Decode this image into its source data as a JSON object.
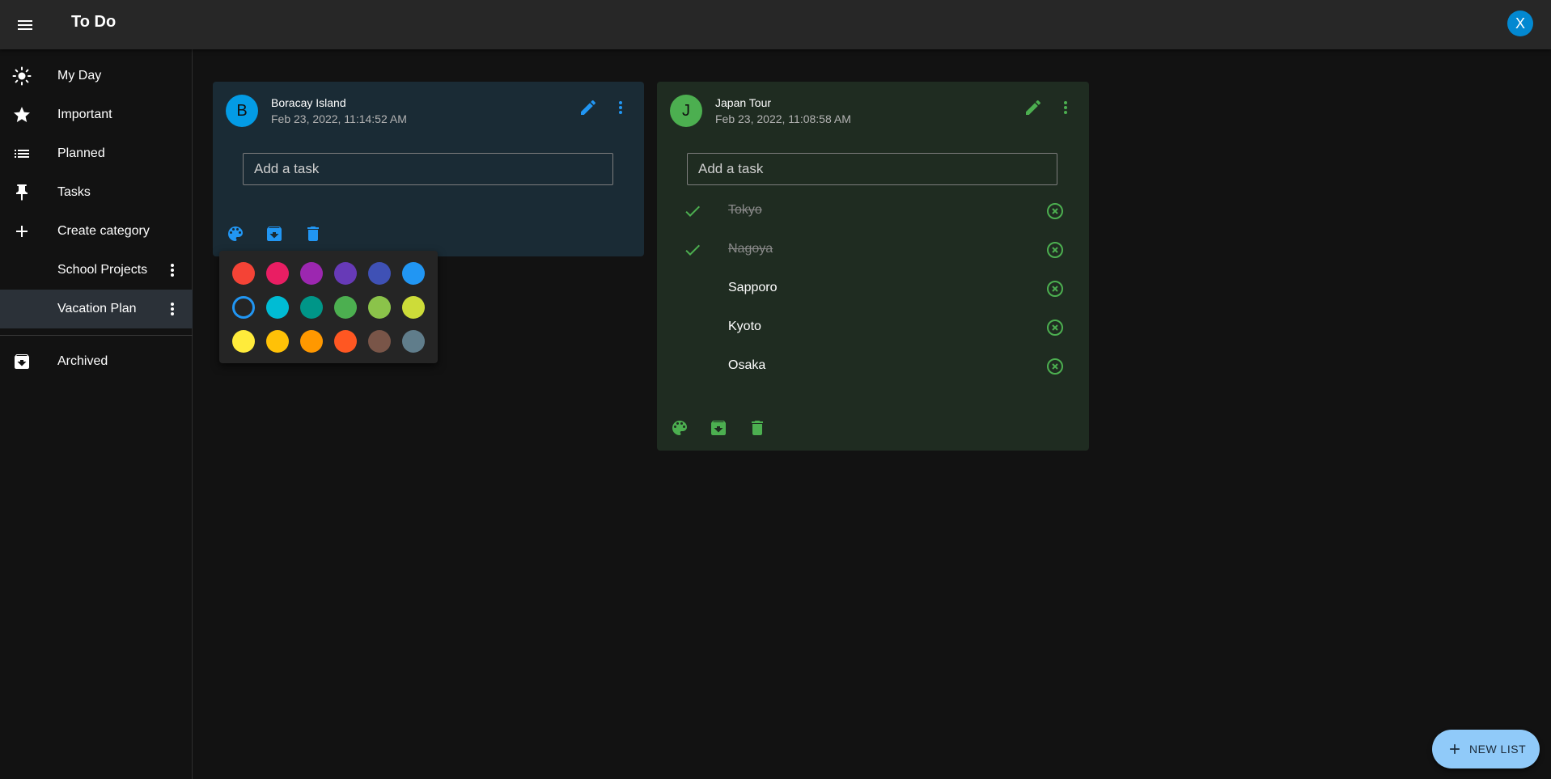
{
  "app": {
    "title": "To Do",
    "user_initial": "X",
    "colors": {
      "appbar": "#272727",
      "background": "#121212",
      "accent_blue": "#2196f3",
      "accent_green": "#4caf50",
      "fab": "#90caf9"
    }
  },
  "sidebar": {
    "items": [
      {
        "label": "My Day",
        "icon": "sun-icon"
      },
      {
        "label": "Important",
        "icon": "star-icon"
      },
      {
        "label": "Planned",
        "icon": "list-icon"
      },
      {
        "label": "Tasks",
        "icon": "pin-icon"
      },
      {
        "label": "Create category",
        "icon": "plus-icon"
      }
    ],
    "categories": [
      {
        "label": "School Projects",
        "selected": false
      },
      {
        "label": "Vacation Plan",
        "selected": true
      }
    ],
    "archived": {
      "label": "Archived",
      "icon": "archive-icon"
    }
  },
  "lists": [
    {
      "initial": "B",
      "title": "Boracay Island",
      "date": "Feb 23, 2022, 11:14:52 AM",
      "color": "#2196f3",
      "input_placeholder": "Add a task",
      "tasks": []
    },
    {
      "initial": "J",
      "title": "Japan Tour",
      "date": "Feb 23, 2022, 11:08:58 AM",
      "color": "#4caf50",
      "input_placeholder": "Add a task",
      "tasks": [
        {
          "label": "Tokyo",
          "done": true
        },
        {
          "label": "Nagoya",
          "done": true
        },
        {
          "label": "Sapporo",
          "done": false
        },
        {
          "label": "Kyoto",
          "done": false
        },
        {
          "label": "Osaka",
          "done": false
        }
      ]
    }
  ],
  "palette": {
    "selected": "#ffffff",
    "rows": [
      [
        "#f44336",
        "#e91e63",
        "#9c27b0",
        "#673ab7",
        "#3f51b5",
        "#2196f3"
      ],
      [
        "#ffffff",
        "#00bcd4",
        "#009688",
        "#4caf50",
        "#8bc34a",
        "#cddc39"
      ],
      [
        "#ffeb3b",
        "#ffc107",
        "#ff9800",
        "#ff5722",
        "#795548",
        "#607d8b"
      ]
    ]
  },
  "fab": {
    "label": "NEW LIST",
    "icon": "plus-icon"
  }
}
